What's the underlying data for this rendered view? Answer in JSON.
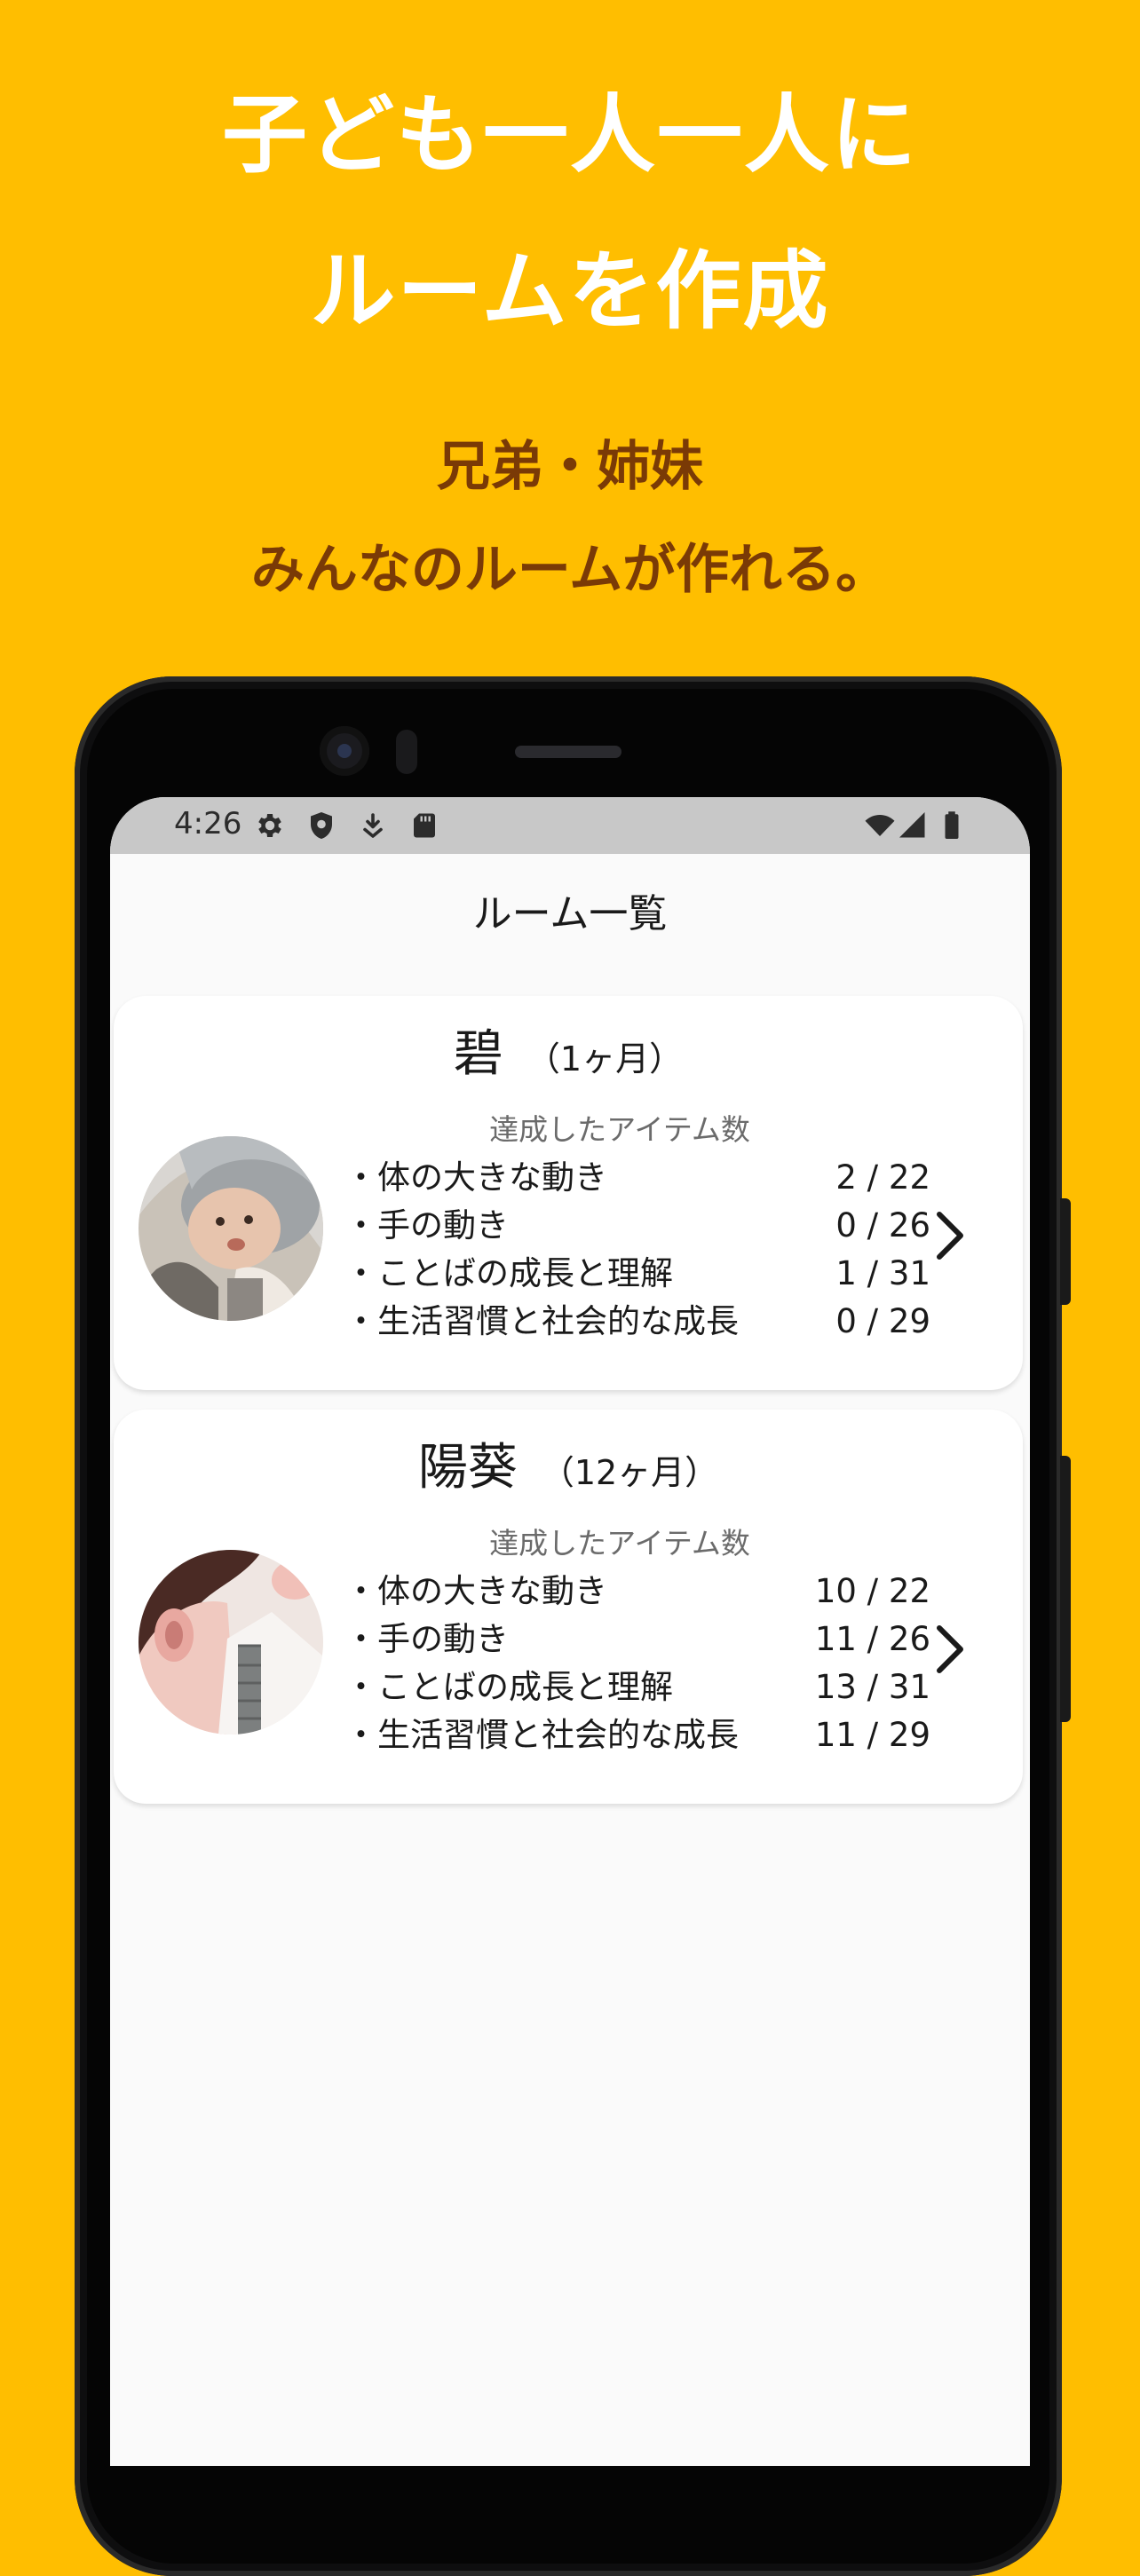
{
  "promo": {
    "headline_line1": "子ども一人一人に",
    "headline_line2": "ルームを作成",
    "subline_line1": "兄弟・姉妹",
    "subline_line2": "みんなのルームが作れる。"
  },
  "colors": {
    "background": "#FFBE00",
    "headline": "#FFFFFF",
    "subline": "#7A3A06",
    "statusbar": "#C8C8C8",
    "screen": "#FAFAFA",
    "card": "#FFFFFF"
  },
  "status_bar": {
    "time": "4:26",
    "left_icons": [
      "gear-icon",
      "shield-icon",
      "download-icon",
      "sd-card-icon"
    ],
    "right_icons": [
      "wifi-icon",
      "signal-icon",
      "battery-icon"
    ]
  },
  "app": {
    "title": "ルーム一覧"
  },
  "rooms": [
    {
      "name": "碧",
      "age": "（1ヶ月）",
      "progress_label": "達成したアイテム数",
      "items": [
        {
          "label": "体の大きな動き",
          "count": "2 / 22"
        },
        {
          "label": "手の動き",
          "count": "0 / 26"
        },
        {
          "label": "ことばの成長と理解",
          "count": "1 / 31"
        },
        {
          "label": "生活習慣と社会的な成長",
          "count": "0 / 29"
        }
      ]
    },
    {
      "name": "陽葵",
      "age": "（12ヶ月）",
      "progress_label": "達成したアイテム数",
      "items": [
        {
          "label": "体の大きな動き",
          "count": "10 / 22"
        },
        {
          "label": "手の動き",
          "count": "11 / 26"
        },
        {
          "label": "ことばの成長と理解",
          "count": "13 / 31"
        },
        {
          "label": "生活習慣と社会的な成長",
          "count": "11 / 29"
        }
      ]
    }
  ]
}
